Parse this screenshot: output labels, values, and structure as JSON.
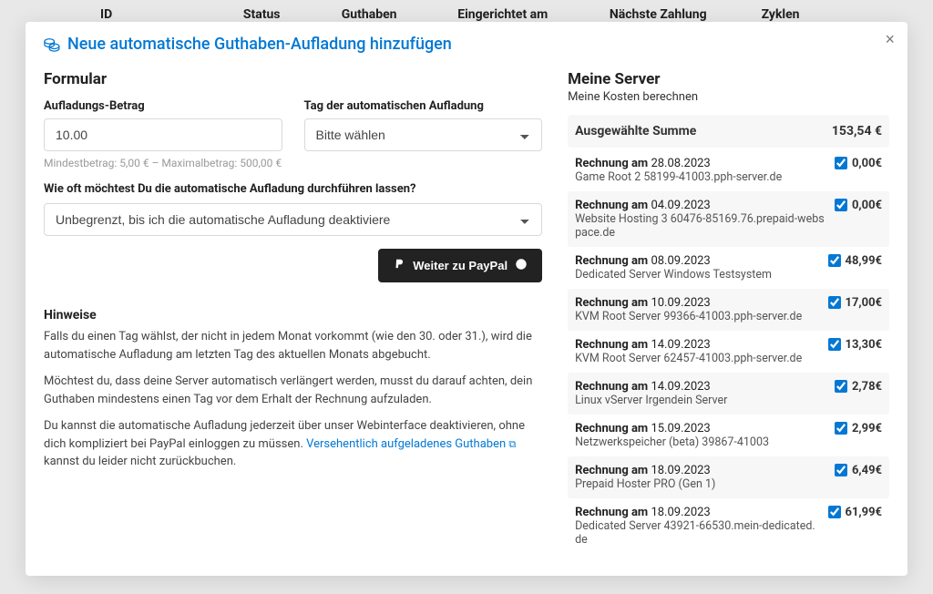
{
  "bg_table": {
    "headers": [
      "ID",
      "Status",
      "Guthaben",
      "Eingerichtet am",
      "Nächste Zahlung",
      "Zyklen"
    ]
  },
  "modal": {
    "title": "Neue automatische Guthaben-Aufladung hinzufügen",
    "close_label": "×"
  },
  "form": {
    "heading": "Formular",
    "amount": {
      "label": "Aufladungs-Betrag",
      "value": "10.00"
    },
    "day": {
      "label": "Tag der automatischen Aufladung",
      "value": "Bitte wählen"
    },
    "min_max": "Mindestbetrag: 5,00 € – Maximalbetrag: 500,00 €",
    "freq": {
      "label": "Wie oft möchtest Du die automatische Aufladung durchführen lassen?",
      "value": "Unbegrenzt, bis ich die automatische Aufladung deaktiviere"
    },
    "submit": "Weiter zu PayPal"
  },
  "hints": {
    "heading": "Hinweise",
    "p1": "Falls du einen Tag wählst, der nicht in jedem Monat vorkommt (wie den 30. oder 31.), wird die automatische Aufladung am letzten Tag des aktuellen Monats abgebucht.",
    "p2": "Möchtest du, dass deine Server automatisch verlängert werden, musst du darauf achten, dein Guthaben mindestens einen Tag vor dem Erhalt der Rechnung aufzuladen.",
    "p3_a": "Du kannst die automatische Aufladung jederzeit über unser Webinterface deaktivieren, ohne dich kompliziert bei PayPal einloggen zu müssen. ",
    "p3_link": "Versehentlich aufgeladenes Guthaben",
    "p3_b": " kannst du leider nicht zurückbuchen."
  },
  "right": {
    "heading": "Meine Server",
    "subtitle": "Meine Kosten berechnen",
    "sum_label": "Ausgewählte Summe",
    "sum_value": "153,54 €",
    "bill_prefix": "Rechnung am",
    "items": [
      {
        "date": "28.08.2023",
        "name": "Game Root 2 58199-41003.pph-server.de",
        "price": "0,00€"
      },
      {
        "date": "04.09.2023",
        "name": "Website Hosting 3 60476-85169.76.prepaid-webspace.de",
        "price": "0,00€"
      },
      {
        "date": "08.09.2023",
        "name": "Dedicated Server Windows Testsystem",
        "price": "48,99€"
      },
      {
        "date": "10.09.2023",
        "name": "KVM Root Server 99366-41003.pph-server.de",
        "price": "17,00€"
      },
      {
        "date": "14.09.2023",
        "name": "KVM Root Server 62457-41003.pph-server.de",
        "price": "13,30€"
      },
      {
        "date": "14.09.2023",
        "name": "Linux vServer Irgendein Server",
        "price": "2,78€"
      },
      {
        "date": "15.09.2023",
        "name": "Netzwerkspeicher (beta) 39867-41003",
        "price": "2,99€"
      },
      {
        "date": "18.09.2023",
        "name": "Prepaid Hoster PRO (Gen 1)",
        "price": "6,49€"
      },
      {
        "date": "18.09.2023",
        "name": "Dedicated Server 43921-66530.mein-dedicated.de",
        "price": "61,99€"
      }
    ]
  }
}
